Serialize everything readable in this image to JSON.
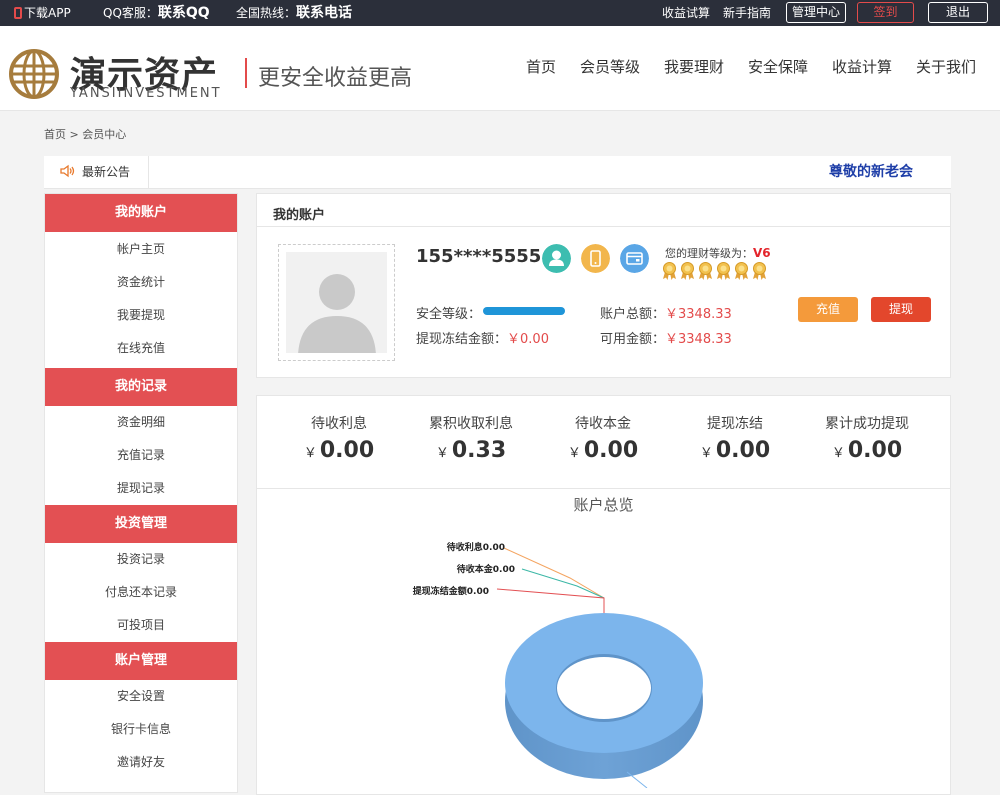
{
  "topbar": {
    "app": "下载APP",
    "qq_label": "QQ客服：",
    "qq_value": "联系QQ",
    "hotline_label": "全国热线：",
    "hotline_value": "联系电话",
    "links": [
      "收益试算",
      "新手指南"
    ],
    "manage": "管理中心",
    "sign": "签到",
    "logout": "退出"
  },
  "header": {
    "logo_cn": "演示资产",
    "logo_en": "YANSIINVESTMENT",
    "slogan": "更安全收益更高",
    "nav": [
      "首页",
      "会员等级",
      "我要理财",
      "安全保障",
      "收益计算",
      "关于我们"
    ]
  },
  "breadcrumb": "首页 > 会员中心",
  "notice": {
    "label": "最新公告",
    "text": "尊敬的新老会"
  },
  "sidebar": {
    "groups": [
      {
        "title": "我的账户",
        "items": [
          "帐户主页",
          "资金统计",
          "我要提现",
          "在线充值"
        ]
      },
      {
        "title": "我的记录",
        "items": [
          "资金明细",
          "充值记录",
          "提现记录"
        ]
      },
      {
        "title": "投资管理",
        "items": [
          "投资记录",
          "付息还本记录",
          "可投项目"
        ]
      },
      {
        "title": "账户管理",
        "items": [
          "安全设置",
          "银行卡信息",
          "邀请好友"
        ]
      }
    ]
  },
  "account": {
    "title": "我的账户",
    "phone": "155****5555",
    "level_label": "您的理财等级为：",
    "level": "V6",
    "safety_label": "安全等级：",
    "safety_level": 1.0,
    "frozen_label": "提现冻结金额：",
    "frozen_value": "￥0.00",
    "total_label": "账户总额：",
    "total_value": "￥3348.33",
    "available_label": "可用金额：",
    "available_value": "￥3348.33",
    "recharge": "充值",
    "withdraw": "提现",
    "medal_count": 6
  },
  "stats": [
    {
      "label": "待收利息",
      "currency": "￥",
      "value": "0.00"
    },
    {
      "label": "累积收取利息",
      "currency": "￥",
      "value": "0.33"
    },
    {
      "label": "待收本金",
      "currency": "￥",
      "value": "0.00"
    },
    {
      "label": "提现冻结",
      "currency": "￥",
      "value": "0.00"
    },
    {
      "label": "累计成功提现",
      "currency": "￥",
      "value": "0.00"
    }
  ],
  "chart_data": {
    "type": "pie",
    "title": "账户总览",
    "labels": [
      "待收利息0.00",
      "待收本金0.00",
      "提现冻结金额0.00"
    ],
    "values": [
      0.0,
      0.0,
      0.0
    ],
    "colors": [
      "#f4a460",
      "#3cb7a6",
      "#e35053",
      "#7cb5ec"
    ]
  }
}
